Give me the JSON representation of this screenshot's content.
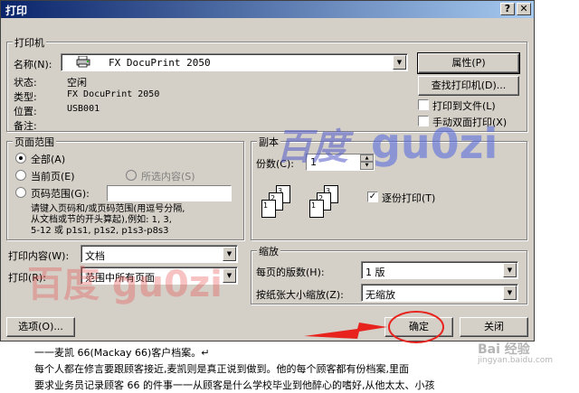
{
  "dialog": {
    "title": "打印",
    "help_btn": "?",
    "close_btn": "✕"
  },
  "printer": {
    "group_label": "打印机",
    "name_label": "名称(N):",
    "name_value": "FX DocuPrint 2050",
    "properties_btn": "属性(P)",
    "find_btn": "查找打印机(D)...",
    "status_label": "状态:",
    "status_value": "空闲",
    "type_label": "类型:",
    "type_value": "FX DocuPrint 2050",
    "location_label": "位置:",
    "location_value": "USB001",
    "note_label": "备注:",
    "print_to_file": "打印到文件(L)",
    "duplex": "手动双面打印(X)"
  },
  "range": {
    "group_label": "页面范围",
    "all": "全部(A)",
    "current": "当前页(E)",
    "selection": "所选内容(S)",
    "pages": "页码范围(G):",
    "hint": "请键入页码和/或页码范围(用逗号分隔,\n从文档或节的开头算起),例如: 1, 3,\n5-12 或 p1s1, p1s2, p1s3-p8s3"
  },
  "copies": {
    "group_label": "副本",
    "count_label": "份数(C):",
    "count_value": "1",
    "collate": "逐份打印(T)"
  },
  "content": {
    "what_label": "打印内容(W):",
    "what_value": "文档",
    "print_label": "打印(R):",
    "print_value": "范围中所有页面"
  },
  "zoom": {
    "group_label": "缩放",
    "per_sheet_label": "每页的版数(H):",
    "per_sheet_value": "1 版",
    "scale_label": "按纸张大小缩放(Z):",
    "scale_value": "无缩放"
  },
  "footer": {
    "options_btn": "选项(O)...",
    "ok_btn": "确定",
    "cancel_btn": "关闭"
  },
  "watermarks": {
    "mark1": "百度",
    "mark2": "gu0zi",
    "mark3": "百度 gu0zi",
    "corner": "Bai 经验",
    "corner_url": "jingyan.baidu.com"
  },
  "document_text": {
    "line1": "一一麦凯 66(Mackay 66)客户档案。↵",
    "line2": "每个人都在修言要跟顾客接近,麦凯则是真正说到做到。他的每个顾客都有份档案,里面",
    "line3": "要求业务员记录顾客 66 的件事一一从顾客是什么学校毕业到他醉心的嗜好,从他太太、小孩"
  },
  "colors": {
    "dialog_bg": "#d4d0c8",
    "title_start": "#0a246a",
    "title_end": "#a6caf0",
    "annotation": "#e8231e",
    "watermark_blue": "#3344cc"
  }
}
